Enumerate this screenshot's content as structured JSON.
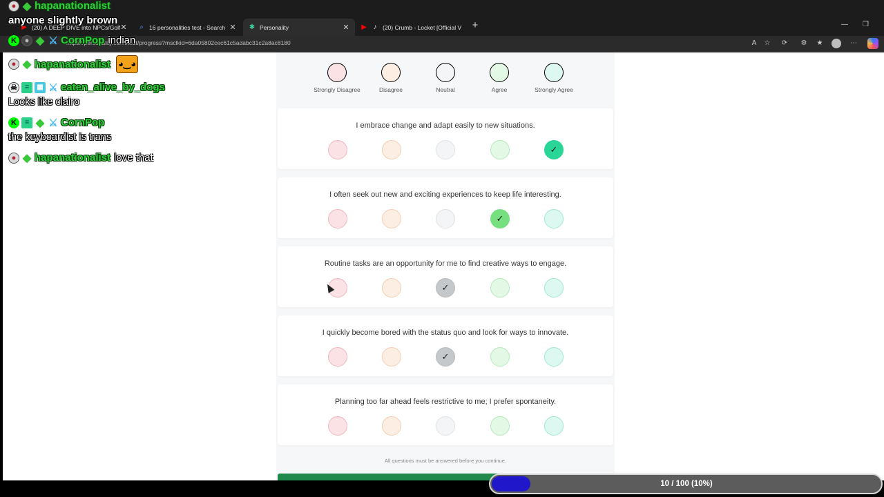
{
  "browser": {
    "tabs": [
      {
        "title": "(20) A DEEP DIVE into NPCs/Golf",
        "icon": "youtube-icon"
      },
      {
        "title": "16 personalities test - Search",
        "icon": "search-icon"
      },
      {
        "title": "Personality",
        "icon": "personality-site-icon"
      },
      {
        "title": "(20) Crumb - Locket [Official V",
        "icon": "youtube-icon"
      }
    ],
    "url": "https://personality.co/.../test/progress?msclkid=6da05802cec61c5adabc31c2a8ac8180"
  },
  "quiz": {
    "scale_labels": [
      "Strongly Disagree",
      "Disagree",
      "Neutral",
      "Agree",
      "Strongly Agree"
    ],
    "questions": [
      {
        "text": "I embrace change and adapt easily to new situations.",
        "selected": 5
      },
      {
        "text": "I often seek out new and exciting experiences to keep life interesting.",
        "selected": 4
      },
      {
        "text": "Routine tasks are an opportunity for me to find creative ways to engage.",
        "selected": 3
      },
      {
        "text": "I quickly become bored with the status quo and look for ways to innovate.",
        "selected": 3
      },
      {
        "text": "Planning too far ahead feels restrictive to me; I prefer spontaneity.",
        "selected": 0
      }
    ],
    "footer_note": "All questions must be answered before you continue."
  },
  "progress": {
    "label": "10 / 100 (10%)",
    "fraction": 0.1
  },
  "chat": {
    "top_user": "hapanationalist",
    "top_message": "anyone slightly brown",
    "messages": [
      {
        "user": "CornPop",
        "text": "indian"
      },
      {
        "user": "hapanationalist",
        "text": ""
      },
      {
        "user": "eaten_alive_by_dogs",
        "text": "Looks like clairo"
      },
      {
        "user": "CornPop",
        "text": "the keyboardist is trans"
      },
      {
        "user": "hapanationalist",
        "text": "love that"
      }
    ]
  },
  "colors": {
    "strongly_agree_selected": "#2ad598",
    "agree_selected": "#76df7f",
    "neutral_selected": "#c5c8cb",
    "progress_fill": "#1f17c9",
    "chat_username": "#2fd03b"
  }
}
